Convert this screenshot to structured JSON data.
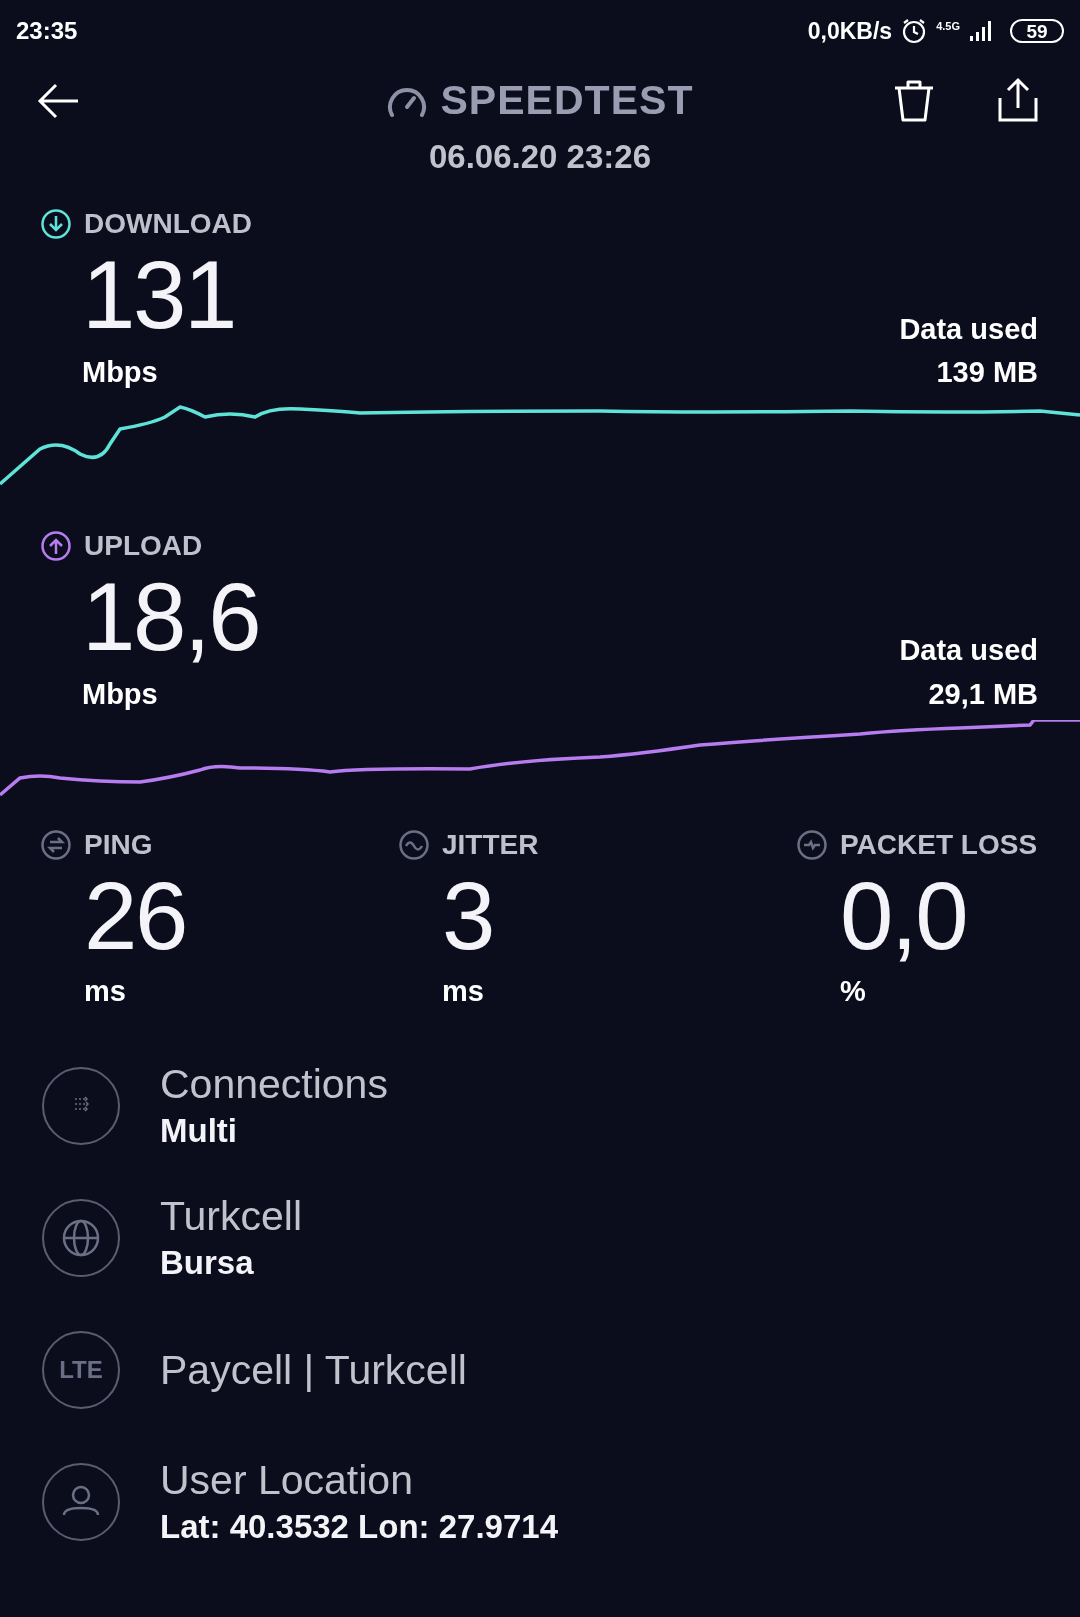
{
  "status_bar": {
    "time": "23:35",
    "net_speed": "0,0KB/s",
    "network_type": "4.5G",
    "battery": "59"
  },
  "header": {
    "title": "SPEEDTEST",
    "date": "06.06.20 23:26"
  },
  "results": [
    {
      "kind": "download",
      "label": "DOWNLOAD",
      "value": "131",
      "unit": "Mbps",
      "data_used_label": "Data used",
      "data_used": "139 MB",
      "color": "#5fe3d8"
    },
    {
      "kind": "upload",
      "label": "UPLOAD",
      "value": "18,6",
      "unit": "Mbps",
      "data_used_label": "Data used",
      "data_used": "29,1 MB",
      "color": "#b67cf0"
    }
  ],
  "metrics": [
    {
      "kind": "ping",
      "label": "PING",
      "value": "26",
      "unit": "ms"
    },
    {
      "kind": "jitter",
      "label": "JITTER",
      "value": "3",
      "unit": "ms"
    },
    {
      "kind": "loss",
      "label": "PACKET LOSS",
      "value": "0,0",
      "unit": "%"
    }
  ],
  "details": [
    {
      "kind": "connections",
      "title": "Connections",
      "subtitle": "Multi"
    },
    {
      "kind": "provider",
      "title": "Turkcell",
      "subtitle": "Bursa"
    },
    {
      "kind": "lte",
      "icon_text": "LTE",
      "title": "Paycell | Turkcell"
    },
    {
      "kind": "location",
      "title": "User Location",
      "subtitle": "Lat: 40.3532 Lon: 27.9714"
    }
  ]
}
